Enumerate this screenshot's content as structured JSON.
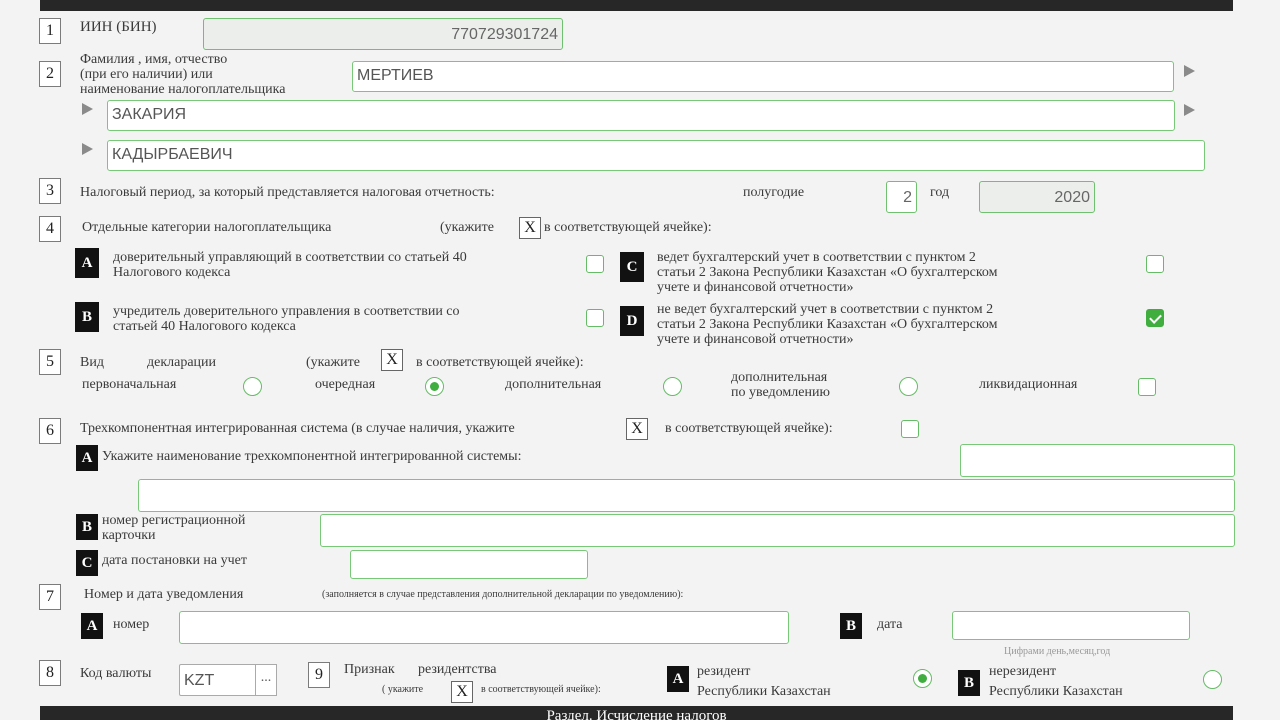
{
  "row1": {
    "num": "1",
    "label": "ИИН (БИН)",
    "value": "770729301724"
  },
  "row2": {
    "num": "2",
    "label_lines": [
      "Фамилия , имя, отчество",
      "(при его наличии) или",
      "наименование налогоплательщика"
    ],
    "last_name": "МЕРТИЕВ",
    "first_name": "ЗАКАРИЯ",
    "patronymic": "КАДЫРБАЕВИЧ"
  },
  "row3": {
    "num": "3",
    "label": "Налоговый период, за который представляется налоговая отчетность:",
    "half_label": "полугодие",
    "half_value": "2",
    "year_label": "год",
    "year_value": "2020"
  },
  "row4": {
    "num": "4",
    "label": "Отдельные категории налогоплательщика",
    "hint_pre": "(укажите",
    "x": "X",
    "hint_post": "в соответствующей ячейке):",
    "a": {
      "letter": "A",
      "lines": [
        "доверительный управляющий в соответствии со статьей 40",
        "Налогового кодекса"
      ]
    },
    "b": {
      "letter": "B",
      "lines": [
        "учредитель доверительного управления в соответствии со",
        "статьей 40 Налогового кодекса"
      ]
    },
    "c": {
      "letter": "C",
      "lines": [
        "ведет бухгалтерский учет в соответствии с пунктом 2",
        "статьи 2 Закона Республики Казахстан «О бухгалтерском",
        "учете и финансовой отчетности»"
      ]
    },
    "d": {
      "letter": "D",
      "lines": [
        "не ведет бухгалтерский учет в соответствии с пунктом 2",
        "статьи 2 Закона Республики Казахстан «О бухгалтерском",
        "учете и финансовой отчетности»"
      ],
      "checked": true
    }
  },
  "row5": {
    "num": "5",
    "vid": "Вид",
    "decl": "декларации",
    "hint_pre": "(укажите",
    "x": "X",
    "hint_post": "в соответствующей ячейке):",
    "opt1": "первоначальная",
    "opt2": "очередная",
    "opt3": "дополнительная",
    "opt4_lines": [
      "дополнительная",
      "по уведомлению"
    ],
    "opt5": "ликвидационная",
    "selected": "очередная"
  },
  "row6": {
    "num": "6",
    "label": "Трехкомпонентная интегрированная система (в случае наличия, укажите",
    "x": "X",
    "hint_post": "в соответствующей ячейке):",
    "a_letter": "A",
    "a_label": "Укажите наименование трехкомпонентной интегрированной системы:",
    "b_letter": "B",
    "b_lines": [
      "номер регистрационной",
      "карточки"
    ],
    "c_letter": "C",
    "c_label": "дата постановки на учет"
  },
  "row7": {
    "num": "7",
    "label": "Номер и дата уведомления",
    "note": "(заполняется в случае представления дополнительной декларации по уведомлению):",
    "a_letter": "A",
    "a_label": "номер",
    "b_letter": "B",
    "b_label": "дата",
    "date_hint": "Цифрами день,месяц,год"
  },
  "row8": {
    "num": "8",
    "label": "Код валюты",
    "value": "KZT",
    "btn": "..."
  },
  "row9": {
    "num": "9",
    "label_a": "Признак",
    "label_b": "резидентства",
    "hint_pre": "( укажите",
    "x": "X",
    "hint_post": "в соответствующей ячейке):",
    "a_letter": "A",
    "a_lines": [
      "резидент",
      "Республики Казахстан"
    ],
    "b_letter": "B",
    "b_lines": [
      "нерезидент",
      "Республики Казахстан"
    ],
    "selected": "резидент"
  },
  "footer": "Раздел. Исчисление налогов"
}
